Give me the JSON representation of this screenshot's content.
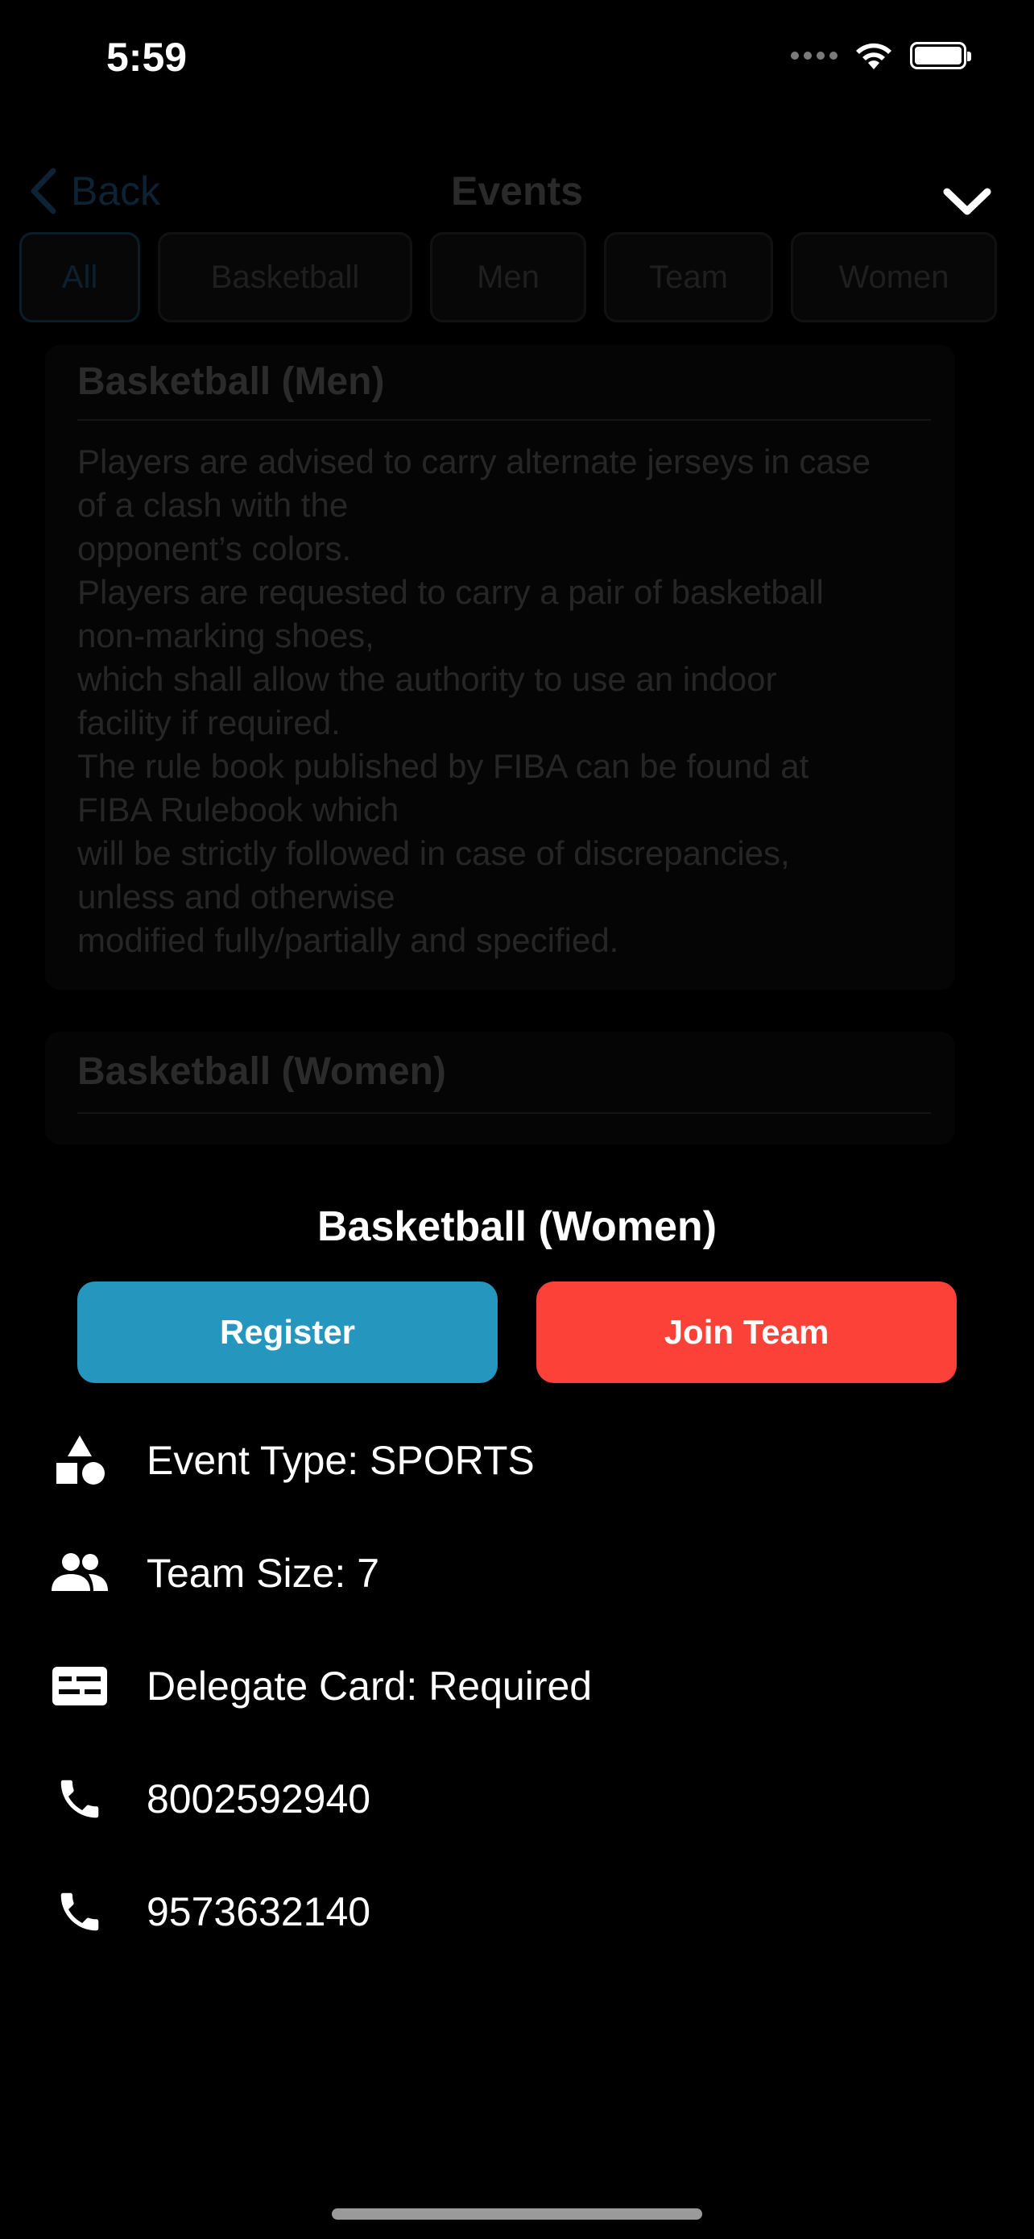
{
  "status_bar": {
    "time": "5:59"
  },
  "nav": {
    "back_label": "Back",
    "title": "Events"
  },
  "filters": [
    {
      "label": "All",
      "active": true
    },
    {
      "label": "Basketball",
      "active": false
    },
    {
      "label": "Men",
      "active": false
    },
    {
      "label": "Team",
      "active": false
    },
    {
      "label": "Women",
      "active": false
    }
  ],
  "events": [
    {
      "title": "Basketball (Men)",
      "description": "Players are advised to carry alternate jerseys in case\nof a clash with the\nopponent’s colors.\nPlayers are requested to carry a pair of basketball\nnon-marking shoes,\nwhich shall allow the authority to use an indoor\nfacility if required.\nThe rule book published by FIBA can be found at\nFIBA Rulebook which\nwill be strictly followed in case of discrepancies,\nunless and otherwise\nmodified fully/partially and specified."
    },
    {
      "title": "Basketball (Women)"
    }
  ],
  "sheet": {
    "title": "Basketball (Women)",
    "register_label": "Register",
    "join_label": "Join Team",
    "rows": [
      {
        "icon": "shapes-icon",
        "text": "Event Type: SPORTS"
      },
      {
        "icon": "people-icon",
        "text": "Team Size: 7"
      },
      {
        "icon": "id-card-icon",
        "text": "Delegate Card: Required"
      },
      {
        "icon": "phone-icon",
        "text": "8002592940"
      },
      {
        "icon": "phone-icon",
        "text": "9573632140"
      }
    ]
  },
  "colors": {
    "register": "#2596be",
    "join": "#fc4138",
    "background": "#000000"
  }
}
